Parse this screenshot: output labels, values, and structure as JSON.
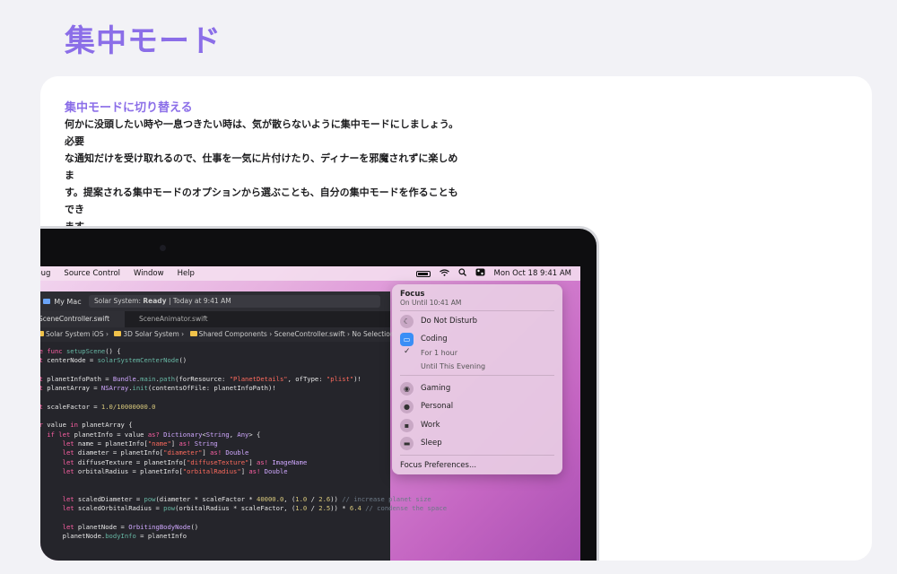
{
  "page": {
    "title": "集中モード"
  },
  "section": {
    "subtitle": "集中モードに切り替える",
    "line1": "何かに没頭したい時や一息つきたい時は、気が散らないように集中モードにしましょう。必要",
    "line2": "な通知だけを受け取れるので、仕事を一気に片付けたり、ディナーを邪魔されずに楽しめま",
    "line3": "す。提案される集中モードのオプションから選ぶことも、自分の集中モードを作ることもでき",
    "line4": "ます。"
  },
  "menubar": {
    "items": [
      "ebug",
      "Source Control",
      "Window",
      "Help"
    ],
    "datetime": "Mon Oct 18  9:41 AM"
  },
  "xcode": {
    "scheme": "My Mac",
    "status_prefix": "Solar System: ",
    "status_bold": "Ready",
    "status_suffix": " | Today at 9:41 AM",
    "tabs": [
      "SceneController.swift",
      "SceneAnimator.swift"
    ],
    "breadcrumbs": [
      "Solar System iOS",
      "3D Solar System",
      "Shared Components",
      "SceneController.swift",
      "No Selection"
    ]
  },
  "focus": {
    "title": "Focus",
    "subtitle": "On Until 10:41 AM",
    "dnd": "Do Not Disturb",
    "coding": "Coding",
    "for_hour": "For 1 hour",
    "until_evening": "Until This Evening",
    "gaming": "Gaming",
    "personal": "Personal",
    "work": "Work",
    "sleep": "Sleep",
    "prefs": "Focus Preferences..."
  },
  "colors": {
    "accent": "#8b6ee8",
    "focus_blue": "#3a8ef6"
  }
}
